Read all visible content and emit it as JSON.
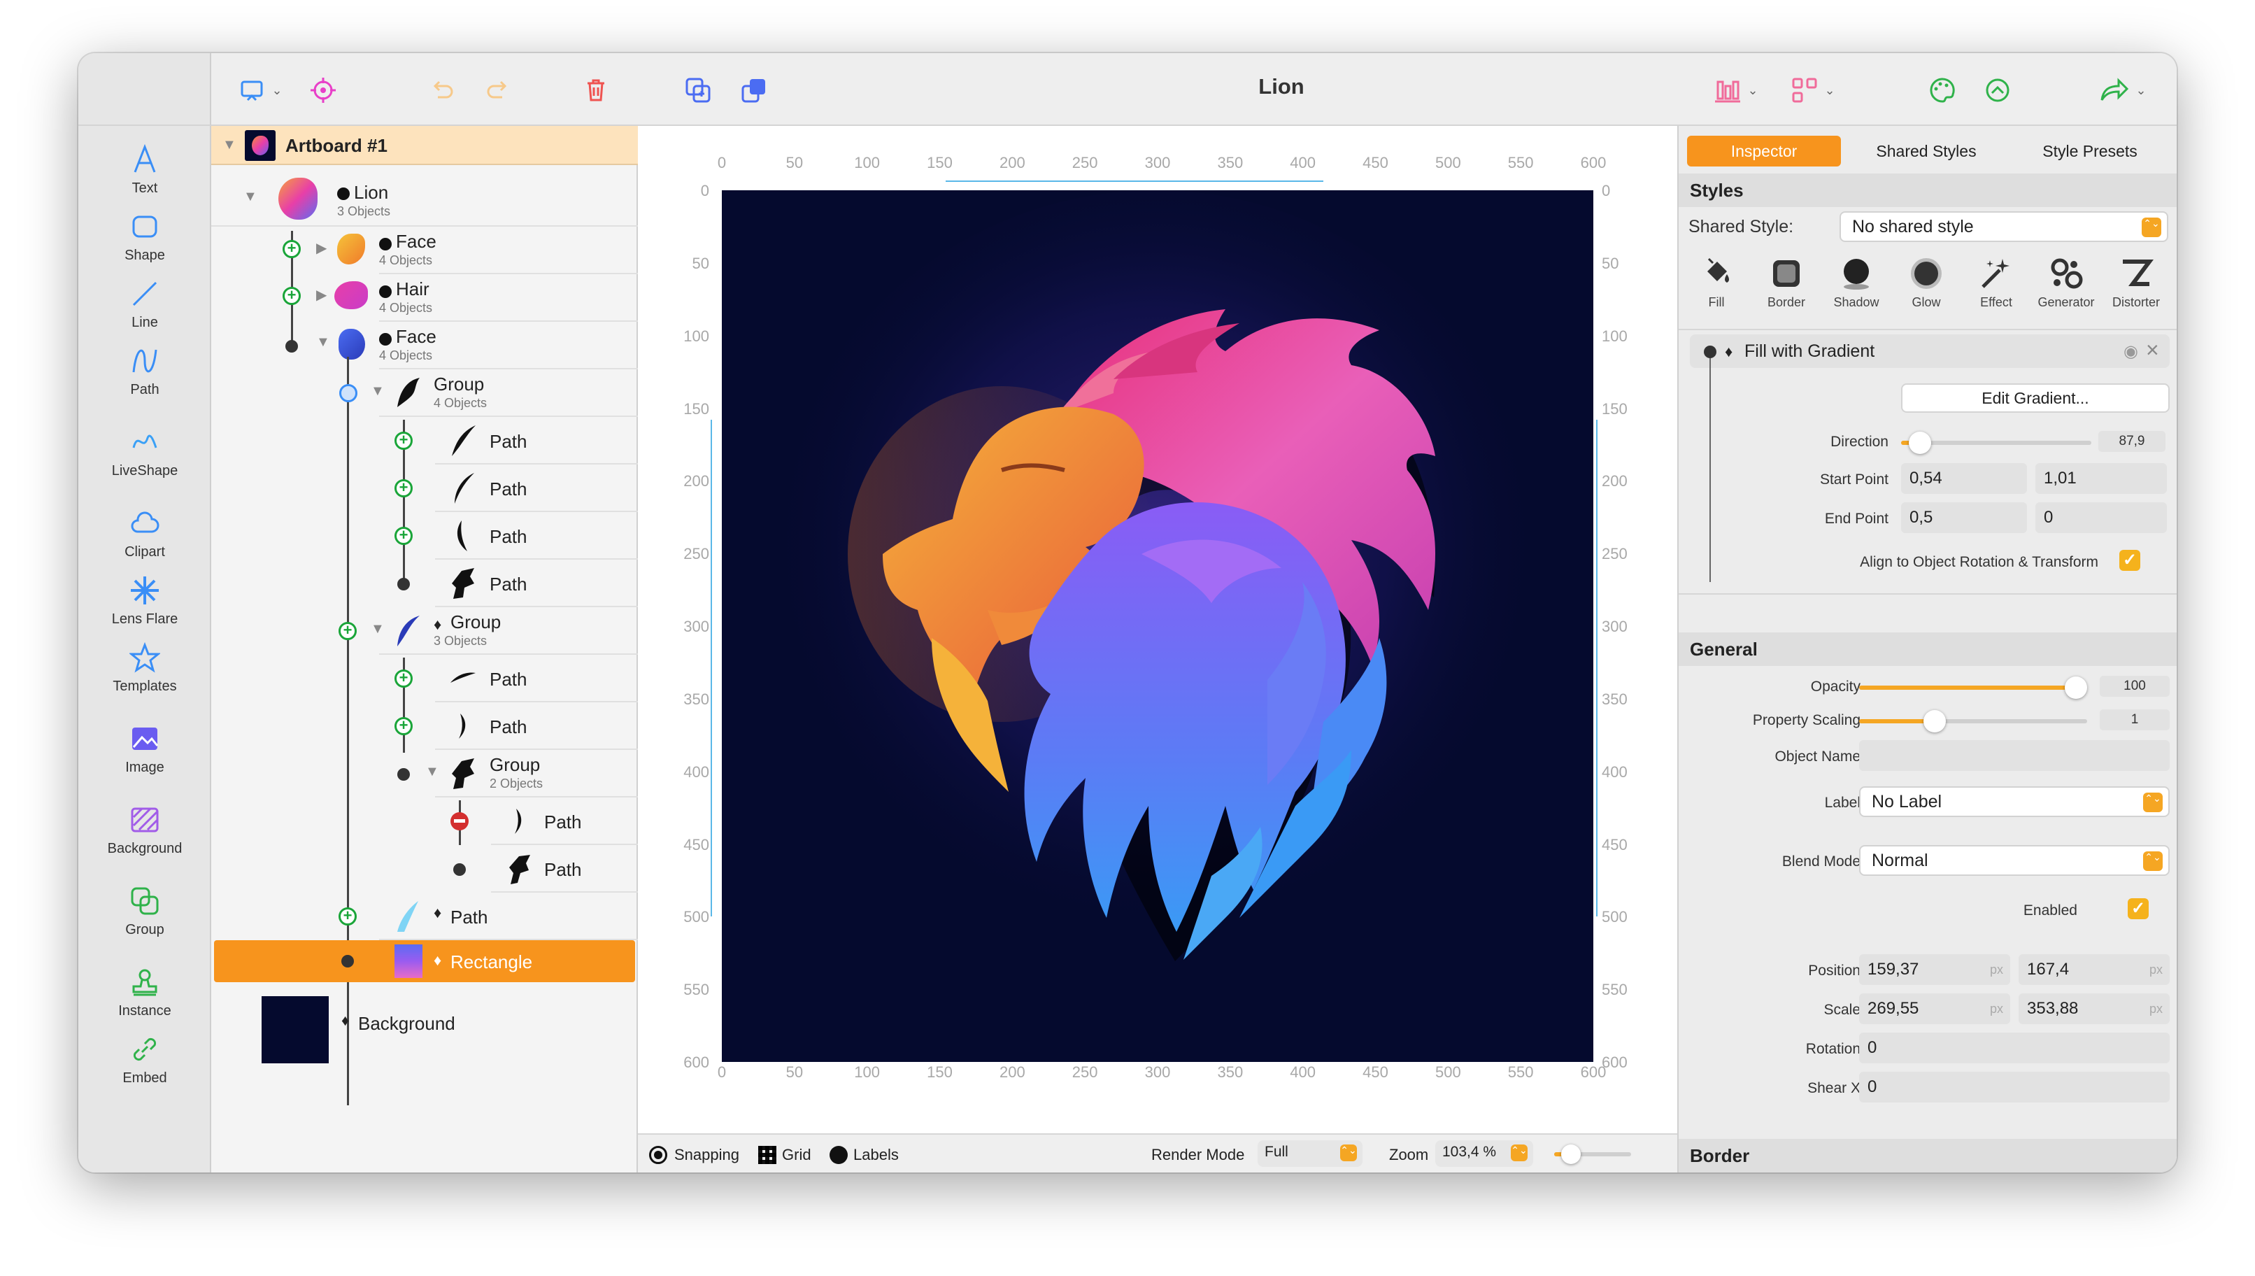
{
  "window": {
    "title": "Lion"
  },
  "tools": [
    {
      "label": "Text"
    },
    {
      "label": "Shape"
    },
    {
      "label": "Line"
    },
    {
      "label": "Path"
    },
    {
      "label": "LiveShape"
    },
    {
      "label": "Clipart"
    },
    {
      "label": "Lens Flare"
    },
    {
      "label": "Templates"
    },
    {
      "label": "Image"
    },
    {
      "label": "Background"
    },
    {
      "label": "Group"
    },
    {
      "label": "Instance"
    },
    {
      "label": "Embed"
    }
  ],
  "layers": {
    "artboard": "Artboard #1",
    "items": [
      {
        "name": "Lion",
        "sub": "3 Objects"
      },
      {
        "name": "Face",
        "sub": "4 Objects"
      },
      {
        "name": "Hair",
        "sub": "4 Objects"
      },
      {
        "name": "Face",
        "sub": "4 Objects"
      },
      {
        "name": "Group",
        "sub": "4 Objects"
      },
      {
        "name": "Path"
      },
      {
        "name": "Path"
      },
      {
        "name": "Path"
      },
      {
        "name": "Path"
      },
      {
        "name": "Group",
        "sub": "3 Objects"
      },
      {
        "name": "Path"
      },
      {
        "name": "Path"
      },
      {
        "name": "Group",
        "sub": "2 Objects"
      },
      {
        "name": "Path"
      },
      {
        "name": "Path"
      },
      {
        "name": "Path"
      },
      {
        "name": "Rectangle"
      },
      {
        "name": "Background"
      }
    ]
  },
  "rulers": {
    "x": [
      "0",
      "50",
      "100",
      "150",
      "200",
      "250",
      "300",
      "350",
      "400",
      "450",
      "500",
      "550",
      "600"
    ],
    "y": [
      "0",
      "50",
      "100",
      "150",
      "200",
      "250",
      "300",
      "350",
      "400",
      "450",
      "500",
      "550",
      "600"
    ]
  },
  "status": {
    "snapping": "Snapping",
    "grid": "Grid",
    "labels": "Labels",
    "render_mode_label": "Render Mode",
    "render_mode": "Full",
    "zoom_label": "Zoom",
    "zoom": "103,4 %"
  },
  "inspector": {
    "tabs": [
      "Inspector",
      "Shared Styles",
      "Style Presets"
    ],
    "styles_header": "Styles",
    "shared_style_label": "Shared Style:",
    "shared_style_value": "No shared style",
    "style_types": [
      "Fill",
      "Border",
      "Shadow",
      "Glow",
      "Effect",
      "Generator",
      "Distorter"
    ],
    "fill": {
      "title": "Fill with Gradient",
      "edit_button": "Edit Gradient...",
      "direction_label": "Direction",
      "direction": "87,9",
      "direction_fraction": 0.04,
      "start_label": "Start Point",
      "start_x": "0,54",
      "start_y": "1,01",
      "end_label": "End Point",
      "end_x": "0,5",
      "end_y": "0",
      "align_label": "Align to Object Rotation & Transform"
    },
    "general_header": "General",
    "general": {
      "opacity_label": "Opacity",
      "opacity": "100",
      "opacity_fraction": 1.0,
      "scaling_label": "Property Scaling",
      "scaling": "1",
      "scaling_fraction": 0.33,
      "object_name_label": "Object Name",
      "object_name": "",
      "label_label": "Label",
      "label_value": "No Label",
      "blend_label": "Blend Mode",
      "blend_value": "Normal",
      "enabled_label": "Enabled",
      "position_label": "Position",
      "pos_x": "159,37",
      "pos_y": "167,4",
      "scale_label": "Scale",
      "scale_x": "269,55",
      "scale_y": "353,88",
      "unit": "px",
      "rotation_label": "Rotation",
      "rotation": "0",
      "shear_label": "Shear X",
      "shear": "0"
    },
    "border_header": "Border"
  },
  "colors": {
    "accent": "#f7941d",
    "canvas_bg": "#050a2e",
    "plus": "#1aa539"
  }
}
